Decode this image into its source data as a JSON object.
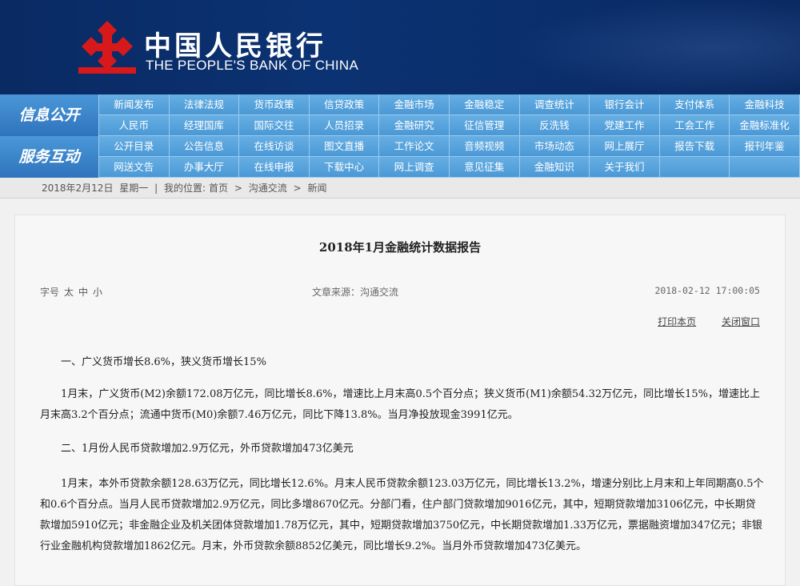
{
  "header": {
    "bank_name_cn": "中国人民银行",
    "bank_name_en": "THE PEOPLE'S BANK OF CHINA",
    "logo_icon": "pboc-logo-icon",
    "logo_color": "#d7191c",
    "banner_color": "#0b2f6b"
  },
  "nav": {
    "info_label": "信息公开",
    "service_label": "服务互动",
    "info_items": [
      "新闻发布",
      "法律法规",
      "货币政策",
      "信贷政策",
      "金融市场",
      "金融稳定",
      "调查统计",
      "银行会计",
      "支付体系",
      "金融科技",
      "人民币",
      "经理国库",
      "国际交往",
      "人员招录",
      "金融研究",
      "征信管理",
      "反洗钱",
      "党建工作",
      "工会工作",
      "金融标准化"
    ],
    "service_items": [
      "公开目录",
      "公告信息",
      "在线访谈",
      "图文直播",
      "工作论文",
      "音频视频",
      "市场动态",
      "网上展厅",
      "报告下载",
      "报刊年鉴",
      "网送文告",
      "办事大厅",
      "在线申报",
      "下载中心",
      "网上调查",
      "意见征集",
      "金融知识",
      "关于我们",
      "",
      ""
    ]
  },
  "breadcrumb": {
    "date": "2018年2月12日",
    "weekday": "星期一",
    "location_label": "我的位置:",
    "items": [
      "首页",
      "沟通交流",
      "新闻"
    ]
  },
  "article": {
    "title": "2018年1月金融统计数据报告",
    "font_size_label": "字号",
    "font_sizes": [
      "太",
      "中",
      "小"
    ],
    "source": "文章来源：沟通交流",
    "datetime": "2018-02-12 17:00:05",
    "print_label": "打印本页",
    "close_label": "关闭窗口",
    "paragraphs": [
      "一、广义货币增长8.6%，狭义货币增长15%",
      "1月末，广义货币(M2)余额172.08万亿元，同比增长8.6%，增速比上月末高0.5个百分点；狭义货币(M1)余额54.32万亿元，同比增长15%，增速比上月末高3.2个百分点；流通中货币(M0)余额7.46万亿元，同比下降13.8%。当月净投放现金3991亿元。",
      "二、1月份人民币贷款增加2.9万亿元，外币贷款增加473亿美元",
      "1月末，本外币贷款余额128.63万亿元，同比增长12.6%。月末人民币贷款余额123.03万亿元，同比增长13.2%，增速分别比上月末和上年同期高0.5个和0.6个百分点。当月人民币贷款增加2.9万亿元，同比多增8670亿元。分部门看，住户部门贷款增加9016亿元，其中，短期贷款增加3106亿元，中长期贷款增加5910亿元；非金融企业及机关团体贷款增加1.78万亿元，其中，短期贷款增加3750亿元，中长期贷款增加1.33万亿元，票据融资增加347亿元；非银行业金融机构贷款增加1862亿元。月末，外币贷款余额8852亿美元，同比增长9.2%。当月外币贷款增加473亿美元。"
    ]
  }
}
